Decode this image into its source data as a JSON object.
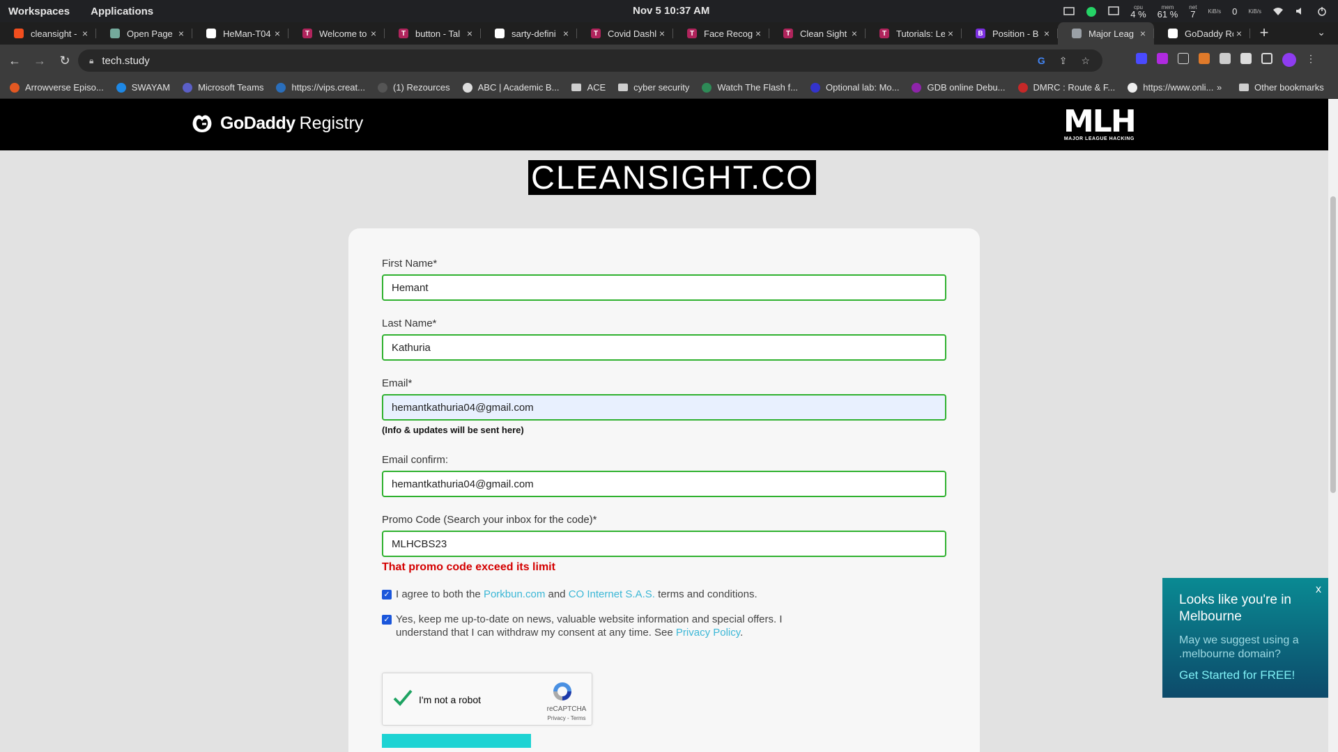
{
  "system": {
    "workspaces": "Workspaces",
    "applications": "Applications",
    "clock": "Nov 5  10:37 AM",
    "cpu_label": "cpu",
    "cpu_value": "4 %",
    "mem_label": "mem",
    "mem_value": "61 %",
    "net_label": "net",
    "net_up": "7",
    "net_up_unit": "KiB/s",
    "net_down": "0",
    "net_down_unit": "KiB/s"
  },
  "tabs": [
    {
      "title": "cleansight -",
      "color": "#f24e1e",
      "glyph": ""
    },
    {
      "title": "Open Page I",
      "color": "#74aa9c",
      "glyph": ""
    },
    {
      "title": "HeMan-T04",
      "color": "#ffffff",
      "glyph": ""
    },
    {
      "title": "Welcome to",
      "color": "#b0245c",
      "glyph": "T"
    },
    {
      "title": "button - Tal",
      "color": "#b0245c",
      "glyph": "T"
    },
    {
      "title": "sarty-defini",
      "color": "#ffffff",
      "glyph": ""
    },
    {
      "title": "Covid Dashl",
      "color": "#b0245c",
      "glyph": "T"
    },
    {
      "title": "Face Recog",
      "color": "#b0245c",
      "glyph": "T"
    },
    {
      "title": "Clean Sight",
      "color": "#b0245c",
      "glyph": "T"
    },
    {
      "title": "Tutorials: Le",
      "color": "#b0245c",
      "glyph": "T"
    },
    {
      "title": "Position - B",
      "color": "#7b2fe0",
      "glyph": "B"
    },
    {
      "title": "Major Leag",
      "color": "#9aa0a6",
      "glyph": "",
      "active": true
    },
    {
      "title": "GoDaddy Ro",
      "color": "#ffffff",
      "glyph": ""
    }
  ],
  "address": {
    "url": "tech.study"
  },
  "bookmarks": [
    {
      "label": "Arrowverse Episo...",
      "color": "#e25822"
    },
    {
      "label": "SWAYAM",
      "color": "#1e88e5"
    },
    {
      "label": "Microsoft Teams",
      "color": "#5b5fc7"
    },
    {
      "label": "https://vips.creat...",
      "color": "#2a6ebb"
    },
    {
      "label": "(1) Rezources",
      "color": "#555555"
    },
    {
      "label": "ABC | Academic B...",
      "color": "#dddddd"
    },
    {
      "label": "ACE",
      "folder": true
    },
    {
      "label": "cyber security",
      "folder": true
    },
    {
      "label": "Watch The Flash f...",
      "color": "#2e8b57"
    },
    {
      "label": "Optional lab: Mo...",
      "color": "#3333cc"
    },
    {
      "label": "GDB online Debu...",
      "color": "#8e24aa"
    },
    {
      "label": "DMRC : Route & F...",
      "color": "#c62828"
    },
    {
      "label": "https://www.onli...",
      "color": "#eeeeee"
    }
  ],
  "bookmarks_other": "Other bookmarks",
  "bookmarks_more": "»",
  "site": {
    "brand": "GoDaddy",
    "brand_suffix": "Registry",
    "mlh_big": "MLH",
    "mlh_small": "MAJOR LEAGUE HACKING",
    "domain_title": "CLEANSIGHT.CO"
  },
  "form": {
    "first_name_label": "First Name*",
    "first_name_value": "Hemant",
    "last_name_label": "Last Name*",
    "last_name_value": "Kathuria",
    "email_label": "Email*",
    "email_value": "hemantkathuria04@gmail.com",
    "email_note": "(Info & updates will be sent here)",
    "email_confirm_label": "Email confirm:",
    "email_confirm_value": "hemantkathuria04@gmail.com",
    "promo_label": "Promo Code (Search your inbox for the code)*",
    "promo_value": "MLHCBS23",
    "promo_error": "That promo code exceed its limit",
    "terms_pre": "I agree to both the ",
    "terms_link1": "Porkbun.com",
    "terms_mid": " and ",
    "terms_link2": "CO Internet S.A.S.",
    "terms_post": " terms and conditions.",
    "terms_checked": true,
    "news_text": "Yes, keep me up-to-date on news, valuable website information and special offers. I understand that I can withdraw my consent at any time. See ",
    "news_link": "Privacy Policy",
    "news_end": ".",
    "news_checked": true
  },
  "recaptcha": {
    "label": "I'm not a robot",
    "brand": "reCAPTCHA",
    "terms": "Privacy - Terms"
  },
  "popup": {
    "close": "x",
    "headline": "Looks like you're in Melbourne",
    "subtext": "May we suggest using a .melbourne domain?",
    "cta": "Get Started for FREE!"
  },
  "colors": {
    "field_border_valid": "#2fb12f",
    "error_text": "#d40000",
    "link": "#3bb7d6",
    "popup_top": "#0a8a93",
    "popup_bottom": "#0d4a6a"
  }
}
